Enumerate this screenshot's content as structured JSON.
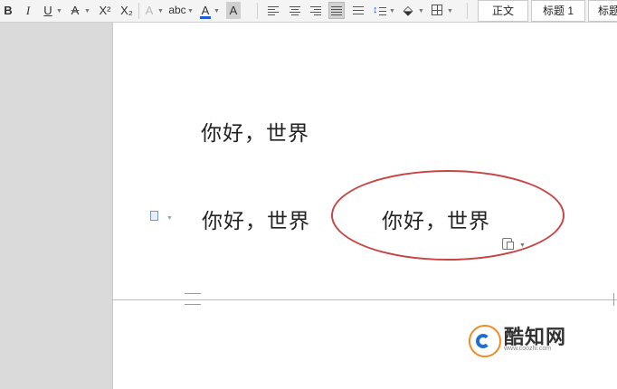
{
  "toolbar": {
    "bold": "B",
    "italic": "I",
    "underline": "U",
    "strikethrough": "A",
    "superscript": "X²",
    "subscript": "X₂",
    "text_effect": "A",
    "pinyin": "abc",
    "font_color": "A",
    "char_shading": "A",
    "style_normal": "正文",
    "style_heading1": "标题 1",
    "style_heading2": "标题"
  },
  "document": {
    "line1": "你好，世界",
    "line2": "你好，世界",
    "pasted": "你好，世界"
  },
  "watermark": {
    "brand": "酷知网",
    "url": "www.coozhi.com"
  },
  "colors": {
    "annotation_circle": "#c94444",
    "font_color_bar": "#1e5bd6",
    "strike_color": "#d22b2b",
    "logo_orange": "#f08a24",
    "logo_blue": "#1f6fd1"
  }
}
